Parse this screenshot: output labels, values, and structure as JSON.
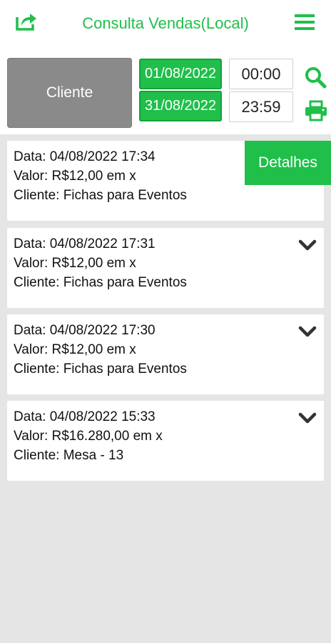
{
  "header": {
    "title": "Consulta Vendas(Local)",
    "share_icon": "share-icon",
    "menu_icon": "hamburger-menu-icon"
  },
  "filters": {
    "cliente_label": "Cliente",
    "date_start": "01/08/2022",
    "date_end": "31/08/2022",
    "time_start": "00:00",
    "time_end": "23:59",
    "search_icon": "search-icon",
    "print_icon": "print-icon"
  },
  "colors": {
    "accent": "#1fbf4a",
    "cliente_button": "#8a8a8a",
    "background": "#e5e5e5"
  },
  "details_button_label": "Detalhes",
  "sales": [
    {
      "data": "Data: 04/08/2022 17:34",
      "valor": "Valor: R$12,00 em x",
      "cliente": "Cliente: Fichas para Eventos"
    },
    {
      "data": "Data: 04/08/2022 17:31",
      "valor": "Valor: R$12,00 em x",
      "cliente": "Cliente: Fichas para Eventos"
    },
    {
      "data": "Data: 04/08/2022 17:30",
      "valor": "Valor: R$12,00 em x",
      "cliente": "Cliente: Fichas para Eventos"
    },
    {
      "data": "Data: 04/08/2022 15:33",
      "valor": "Valor: R$16.280,00 em x",
      "cliente": "Cliente: Mesa - 13"
    }
  ]
}
